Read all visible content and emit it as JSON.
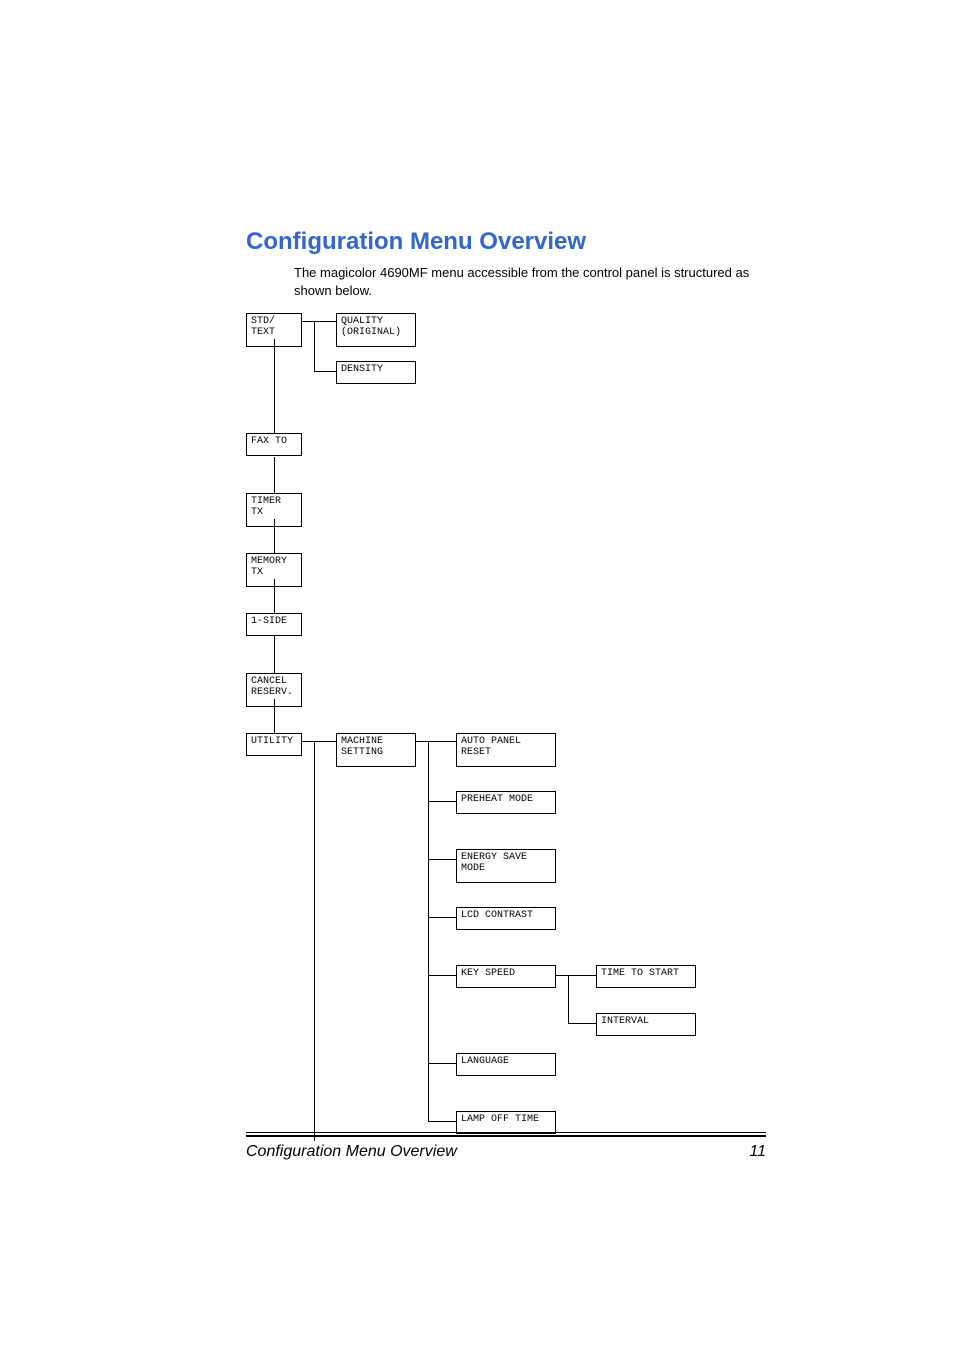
{
  "heading": "Configuration Menu Overview",
  "intro": "The magicolor 4690MF menu accessible from the control panel is structured as shown below.",
  "nodes": {
    "std_text": "STD/\nTEXT",
    "quality": "QUALITY\n(ORIGINAL)",
    "density": "DENSITY",
    "fax_to": "FAX TO",
    "timer_tx": "TIMER\nTX",
    "memory_tx": "MEMORY\nTX",
    "one_side": "1-SIDE",
    "cancel_reserv": "CANCEL\nRESERV.",
    "utility": "UTILITY",
    "machine_setting": "MACHINE\nSETTING",
    "auto_panel_reset": "AUTO PANEL\nRESET",
    "preheat_mode": "PREHEAT MODE",
    "energy_save_mode": "ENERGY SAVE\nMODE",
    "lcd_contrast": "LCD CONTRAST",
    "key_speed": "KEY SPEED",
    "language": "LANGUAGE",
    "lamp_off_time": "LAMP OFF TIME",
    "time_to_start": "TIME TO START",
    "interval": "INTERVAL"
  },
  "footer": {
    "title": "Configuration Menu Overview",
    "page_no": "11"
  }
}
